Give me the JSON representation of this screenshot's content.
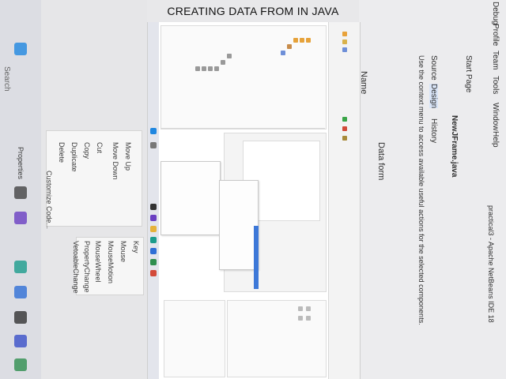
{
  "title": "CREATING DATA FROM IN JAVA",
  "colors": {
    "accent_blue": "#3d78d8",
    "ide_bg": "#ffffff",
    "backdrop": "#e8e8ea"
  },
  "left_menu": {
    "items": [
      "Move Up",
      "Move Down",
      "Cut",
      "Copy",
      "Duplicate",
      "Delete",
      "Customize Code...",
      "Properties"
    ]
  },
  "events_submenu": {
    "items": [
      "Key",
      "Mouse",
      "MouseMotion",
      "MouseWheel",
      "PropertyChange",
      "VetoableChange"
    ]
  },
  "right_backdrop": {
    "menu_labels": [
      "Source",
      "Design",
      "History",
      "Team",
      "Tools",
      "Window",
      "Help",
      "Profile",
      "Debug"
    ],
    "file_tab": "NewJFrame.java",
    "hint": "Use the context menu to access available useful actions for the selected components.",
    "frame_title": "practical3 - Apache NetBeans IDE 18",
    "start_page": "Start Page",
    "name_label": "Name",
    "data_form": "Data form"
  },
  "search_label": "Search"
}
